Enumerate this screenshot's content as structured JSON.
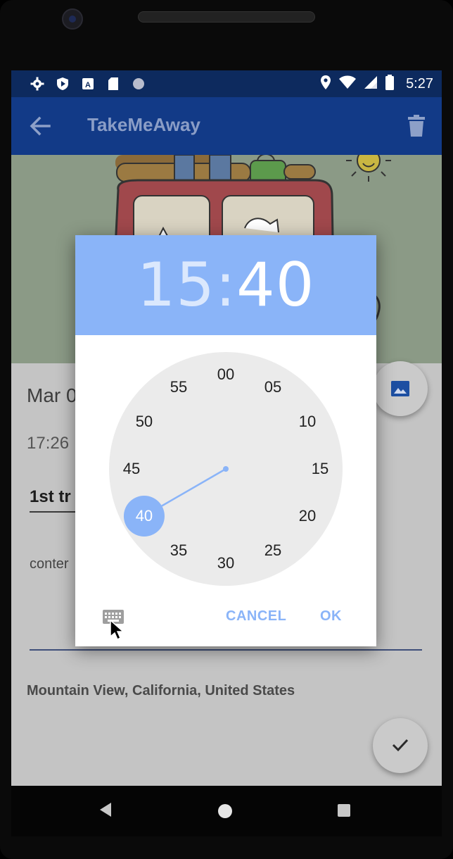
{
  "status_bar": {
    "time": "5:27",
    "left_icons": [
      "settings-icon",
      "shield-play-icon",
      "a-badge-icon",
      "sd-card-icon",
      "dot-icon"
    ],
    "right_icons": [
      "location-pin-icon",
      "wifi-icon",
      "signal-icon",
      "battery-icon"
    ]
  },
  "app_bar": {
    "title": "TakeMeAway",
    "back_icon": "arrow-left-icon",
    "delete_icon": "trash-icon",
    "color": "#123a87"
  },
  "note": {
    "date": "Mar 0",
    "time": "17:26",
    "title": "1st tr",
    "content": "conter",
    "location": "Mountain View, California, United States"
  },
  "time_picker": {
    "hour": "15",
    "separator": ":",
    "minute": "40",
    "selected_minute": "40",
    "minute_labels": [
      "00",
      "05",
      "10",
      "15",
      "20",
      "25",
      "30",
      "35",
      "40",
      "45",
      "50",
      "55"
    ],
    "cancel_label": "CANCEL",
    "ok_label": "OK",
    "accent_color": "#8ab4f8",
    "keyboard_icon": "keyboard-icon"
  },
  "nav_bar": {
    "icons": [
      "nav-back-icon",
      "nav-home-icon",
      "nav-recents-icon"
    ]
  }
}
